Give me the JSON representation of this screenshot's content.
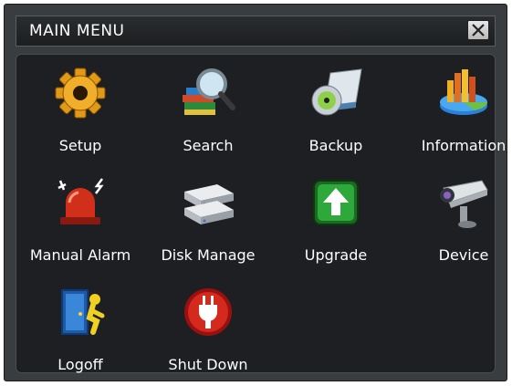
{
  "window": {
    "title": "MAIN MENU",
    "close_label": "X"
  },
  "menu": {
    "items": [
      {
        "label": "Setup",
        "icon": "gear-icon"
      },
      {
        "label": "Search",
        "icon": "search-icon"
      },
      {
        "label": "Backup",
        "icon": "backup-icon"
      },
      {
        "label": "Information",
        "icon": "information-icon"
      },
      {
        "label": "Manual Alarm",
        "icon": "alarm-icon"
      },
      {
        "label": "Disk Manage",
        "icon": "disk-icon"
      },
      {
        "label": "Upgrade",
        "icon": "upgrade-icon"
      },
      {
        "label": "Device",
        "icon": "camera-icon"
      },
      {
        "label": "Logoff",
        "icon": "logoff-icon"
      },
      {
        "label": "Shut Down",
        "icon": "power-icon"
      }
    ]
  }
}
